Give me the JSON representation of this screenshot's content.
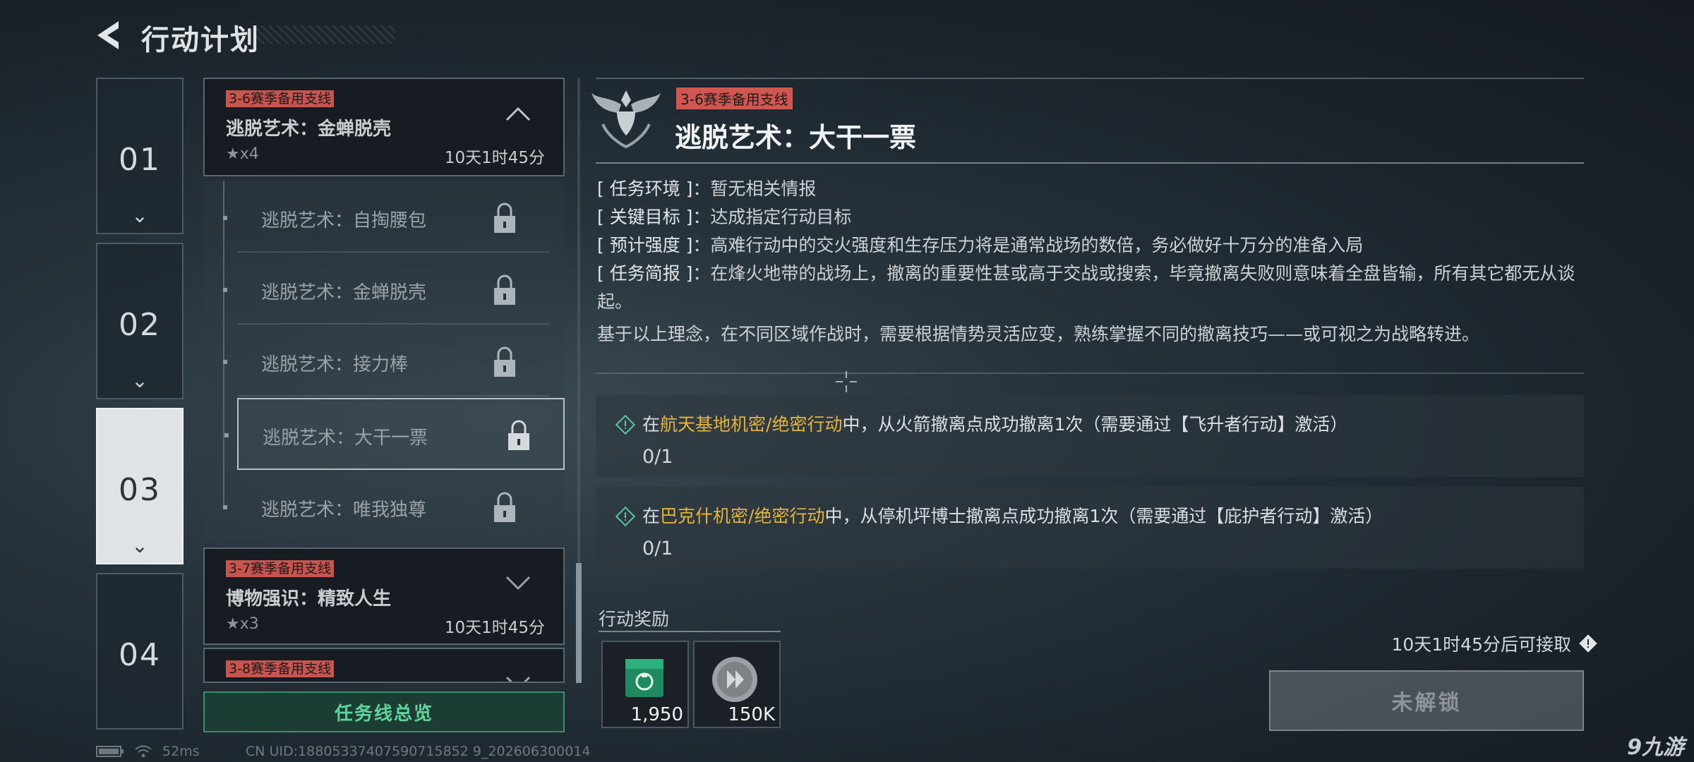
{
  "header": {
    "title": "行动计划",
    "back_icon": "back-arrow-icon"
  },
  "chapters": [
    {
      "label": "01",
      "active": false
    },
    {
      "label": "02",
      "active": false
    },
    {
      "label": "03",
      "active": true
    },
    {
      "label": "04",
      "active": false
    }
  ],
  "mission_lines": [
    {
      "tag": "3-6赛季备用支线",
      "name": "逃脱艺术：金蝉脱壳",
      "stars": "★x4",
      "time": "10天1时45分",
      "expanded": true
    },
    {
      "tag": "3-7赛季备用支线",
      "name": "博物强识：精致人生",
      "stars": "★x3",
      "time": "10天1时45分",
      "expanded": false
    },
    {
      "tag": "3-8赛季备用支线",
      "expanded": false
    }
  ],
  "sub_missions": [
    {
      "label": "逃脱艺术：自掏腰包",
      "locked": true
    },
    {
      "label": "逃脱艺术：金蝉脱壳",
      "locked": true
    },
    {
      "label": "逃脱艺术：接力棒",
      "locked": true
    },
    {
      "label": "逃脱艺术：大干一票",
      "locked": true,
      "selected": true
    },
    {
      "label": "逃脱艺术：唯我独尊",
      "locked": true
    }
  ],
  "overview_button": "任务线总览",
  "detail": {
    "tag": "3-6赛季备用支线",
    "title": "逃脱艺术：大干一票",
    "env_key": "[ 任务环境 ]",
    "env_val": "暂无相关情报",
    "goal_key": "[ 关键目标 ]",
    "goal_val": "达成指定行动目标",
    "intensity_key": "[ 预计强度 ]",
    "intensity_val": "高难行动中的交火强度和生存压力将是通常战场的数倍，务必做好十万分的准备入局",
    "brief_key": "[ 任务简报 ]",
    "brief_val": "在烽火地带的战场上，撤离的重要性甚或高于交战或搜索，毕竟撤离失败则意味着全盘皆输，所有其它都无从谈起。",
    "brief_extra": "基于以上理念，在不同区域作战时，需要根据情势灵活应变，熟练掌握不同的撤离技巧——或可视之为战略转进。"
  },
  "objectives": [
    {
      "prefix": "在",
      "highlight": "航天基地机密/绝密行动",
      "suffix": "中，从火箭撤离点成功撤离1次（需要通过【飞升者行动】激活）",
      "progress": "0/1"
    },
    {
      "prefix": "在",
      "highlight": "巴克什机密/绝密行动",
      "suffix": "中，从停机坪博士撤离点成功撤离1次（需要通过【庇护者行动】激活）",
      "progress": "0/1"
    }
  ],
  "rewards": {
    "label": "行动奖励",
    "items": [
      {
        "icon": "green-badge-icon",
        "amount": "1,950"
      },
      {
        "icon": "silver-coin-icon",
        "amount": "150K"
      }
    ]
  },
  "unlock_hint": "10天1时45分后可接取",
  "unlock_button": "未解锁",
  "status": {
    "ping": "52ms",
    "uid": "CN UID:18805337407590715852 9_202606300014"
  },
  "watermark": "九游",
  "colors": {
    "highlight": "#e6b43a",
    "tag": "#d0564f",
    "overview_green": "#5ed49a"
  }
}
